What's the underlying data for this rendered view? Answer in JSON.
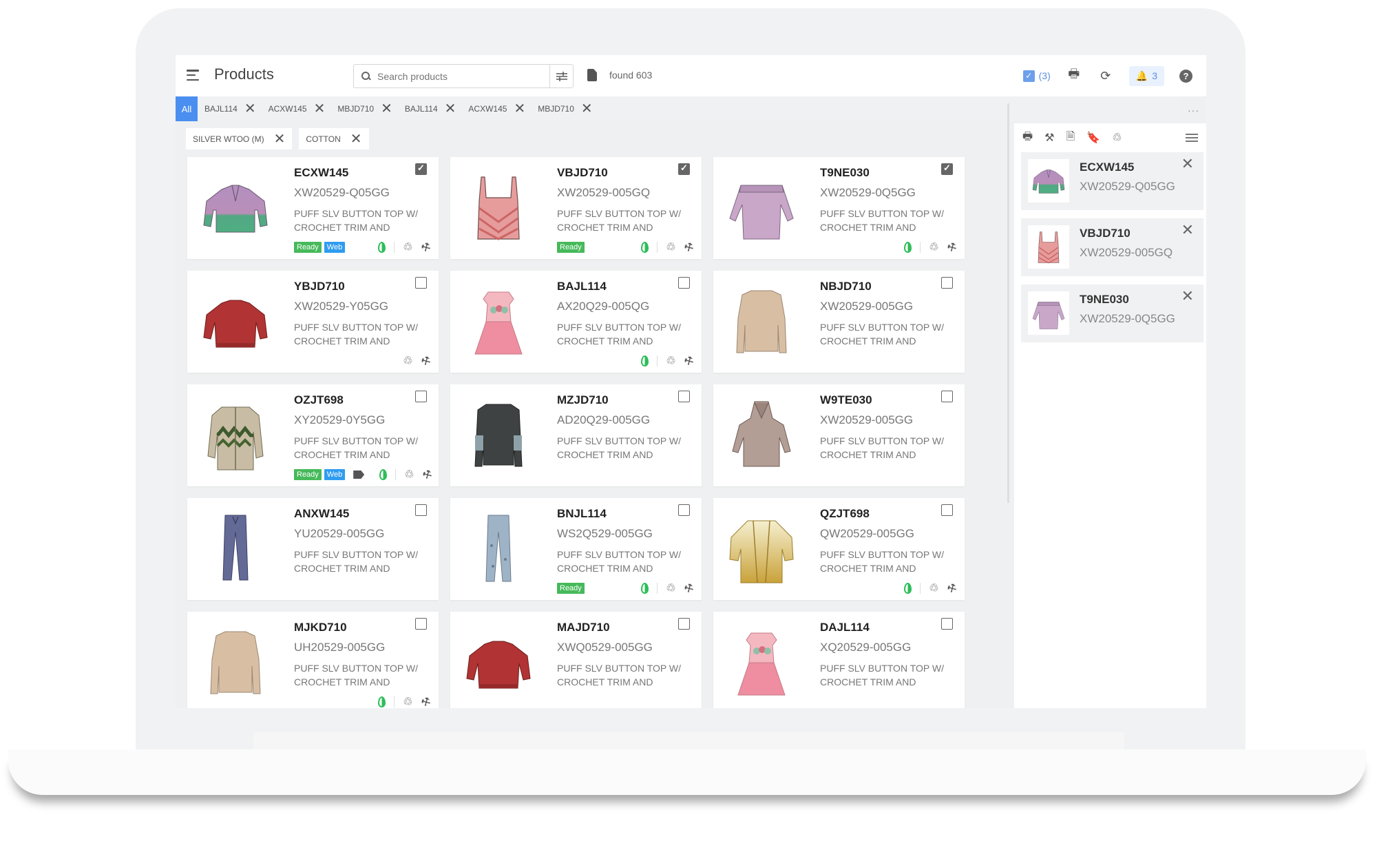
{
  "header": {
    "title": "Products",
    "search_placeholder": "Search products",
    "found_label": "found 603",
    "selected_count": "(3)",
    "notifications_count": "3",
    "help_label": "?"
  },
  "tabs": {
    "all_label": "All",
    "items": [
      {
        "label": "BAJL114"
      },
      {
        "label": "ACXW145"
      },
      {
        "label": "MBJD710"
      },
      {
        "label": "BAJL114"
      },
      {
        "label": "ACXW145"
      },
      {
        "label": "MBJD710"
      }
    ],
    "more_label": "···"
  },
  "filters": {
    "chips": [
      {
        "label": "SILVER WTOO (M)"
      },
      {
        "label": "COTTON"
      }
    ]
  },
  "colors": {
    "accent": "#4a8ef0",
    "ready_badge": "#46b95a",
    "web_badge": "#2f9cf0",
    "eco_icon": "#2ebd59"
  },
  "products": [
    {
      "code": "ECXW145",
      "sku": "XW20529-Q05GG",
      "desc": "PUFF SLV BUTTON TOP W/ CROCHET TRIM AND",
      "checked": true,
      "badges": [
        "Ready",
        "Web"
      ],
      "icons": [
        "leaf",
        "recycle",
        "gavel"
      ],
      "image": "sweater-purple-green"
    },
    {
      "code": "VBJD710",
      "sku": "XW20529-005GQ",
      "desc": "PUFF SLV BUTTON TOP W/ CROCHET TRIM AND",
      "checked": true,
      "badges": [
        "Ready"
      ],
      "icons": [
        "leaf",
        "recycle",
        "gavel"
      ],
      "image": "tank-top-pink"
    },
    {
      "code": "T9NE030",
      "sku": "XW20529-0Q5GG",
      "desc": "PUFF SLV BUTTON TOP W/ CROCHET TRIM AND",
      "checked": true,
      "badges": [],
      "icons": [
        "leaf",
        "recycle",
        "gavel"
      ],
      "image": "offshoulder-lilac"
    },
    {
      "code": "YBJD710",
      "sku": "XW20529-Y05GG",
      "desc": "PUFF SLV BUTTON TOP W/ CROCHET TRIM AND",
      "checked": false,
      "badges": [],
      "icons": [
        "recycle",
        "gavel"
      ],
      "image": "sweater-red"
    },
    {
      "code": "BAJL114",
      "sku": "AX20Q29-005QG",
      "desc": "PUFF SLV BUTTON TOP W/ CROCHET TRIM AND",
      "checked": false,
      "badges": [],
      "icons": [
        "leaf",
        "recycle",
        "gavel"
      ],
      "image": "dress-pink"
    },
    {
      "code": "NBJD710",
      "sku": "XW20529-005GG",
      "desc": "PUFF SLV BUTTON TOP W/ CROCHET TRIM AND",
      "checked": false,
      "badges": [],
      "icons": [],
      "image": "sweater-beige"
    },
    {
      "code": "OZJT698",
      "sku": "XY20529-0Y5GG",
      "desc": "PUFF SLV BUTTON TOP W/ CROCHET TRIM AND",
      "checked": false,
      "badges": [
        "Ready",
        "Web"
      ],
      "icons": [
        "tag",
        "leaf",
        "recycle",
        "gavel"
      ],
      "image": "cardigan-pattern"
    },
    {
      "code": "MZJD710",
      "sku": "AD20Q29-005GG",
      "desc": "PUFF SLV BUTTON TOP W/ CROCHET TRIM AND",
      "checked": false,
      "badges": [],
      "icons": [],
      "image": "sweater-charcoal"
    },
    {
      "code": "W9TE030",
      "sku": "XW20529-005GG",
      "desc": "PUFF SLV BUTTON TOP W/ CROCHET TRIM AND",
      "checked": false,
      "badges": [],
      "icons": [],
      "image": "hoodie-taupe"
    },
    {
      "code": "ANXW145",
      "sku": "YU20529-005GG",
      "desc": "PUFF SLV BUTTON TOP W/ CROCHET TRIM AND",
      "checked": false,
      "badges": [],
      "icons": [],
      "image": "pants-navy"
    },
    {
      "code": "BNJL114",
      "sku": "WS2Q529-005GG",
      "desc": "PUFF SLV BUTTON TOP W/ CROCHET TRIM AND",
      "checked": false,
      "badges": [
        "Ready"
      ],
      "icons": [
        "leaf",
        "recycle",
        "gavel"
      ],
      "image": "pants-lightblue"
    },
    {
      "code": "QZJT698",
      "sku": "QW20529-005GG",
      "desc": "PUFF SLV BUTTON TOP W/ CROCHET TRIM AND",
      "checked": false,
      "badges": [],
      "icons": [
        "leaf",
        "recycle",
        "gavel"
      ],
      "image": "kimono-yellow"
    },
    {
      "code": "MJKD710",
      "sku": "UH20529-005GG",
      "desc": "PUFF SLV BUTTON TOP W/ CROCHET TRIM AND",
      "checked": false,
      "badges": [],
      "icons": [
        "leaf",
        "recycle",
        "gavel"
      ],
      "image": "sweater-beige"
    },
    {
      "code": "MAJD710",
      "sku": "XWQ0529-005GG",
      "desc": "PUFF SLV BUTTON TOP W/ CROCHET TRIM AND",
      "checked": false,
      "badges": [],
      "icons": [],
      "image": "sweater-red"
    },
    {
      "code": "DAJL114",
      "sku": "XQ20529-005GG",
      "desc": "PUFF SLV BUTTON TOP W/ CROCHET TRIM AND",
      "checked": false,
      "badges": [],
      "icons": [],
      "image": "dress-pink"
    }
  ],
  "selection_panel": {
    "tools": [
      "print",
      "gavel",
      "document",
      "bookmark",
      "recycle"
    ],
    "items": [
      {
        "code": "ECXW145",
        "sku": "XW20529-Q05GG",
        "image": "sweater-purple-green"
      },
      {
        "code": "VBJD710",
        "sku": "XW20529-005GQ",
        "image": "tank-top-pink"
      },
      {
        "code": "T9NE030",
        "sku": "XW20529-0Q5GG",
        "image": "offshoulder-lilac"
      }
    ]
  }
}
